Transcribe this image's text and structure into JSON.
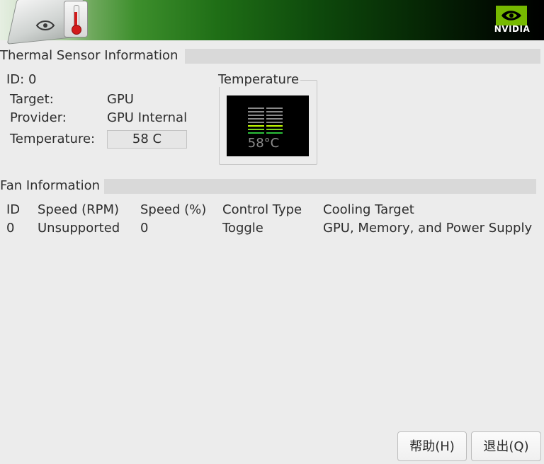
{
  "banner": {
    "brand": "NVIDIA",
    "colors": {
      "green": "#76b900",
      "dark": "#000000"
    }
  },
  "thermal": {
    "section_title": "Thermal Sensor Information",
    "id_line": "ID: 0",
    "target_label": "Target:",
    "target_value": "GPU",
    "provider_label": "Provider:",
    "provider_value": "GPU Internal",
    "temperature_label": "Temperature:",
    "temperature_value": "58 C",
    "gauge": {
      "title": "Temperature",
      "reading": "58°C",
      "segments_total": 8,
      "segments_lit": 3,
      "lit_colors": [
        "#c6ff00",
        "#7ed321",
        "#2cc13a"
      ],
      "unlit_color": "#8a8a8a"
    }
  },
  "fans": {
    "section_title": "Fan Information",
    "columns": [
      "ID",
      "Speed (RPM)",
      "Speed (%)",
      "Control Type",
      "Cooling Target"
    ],
    "rows": [
      [
        "0",
        "Unsupported",
        "0",
        "Toggle",
        "GPU, Memory, and Power Supply"
      ]
    ]
  },
  "buttons": {
    "help": "帮助(H)",
    "quit": "退出(Q)"
  }
}
